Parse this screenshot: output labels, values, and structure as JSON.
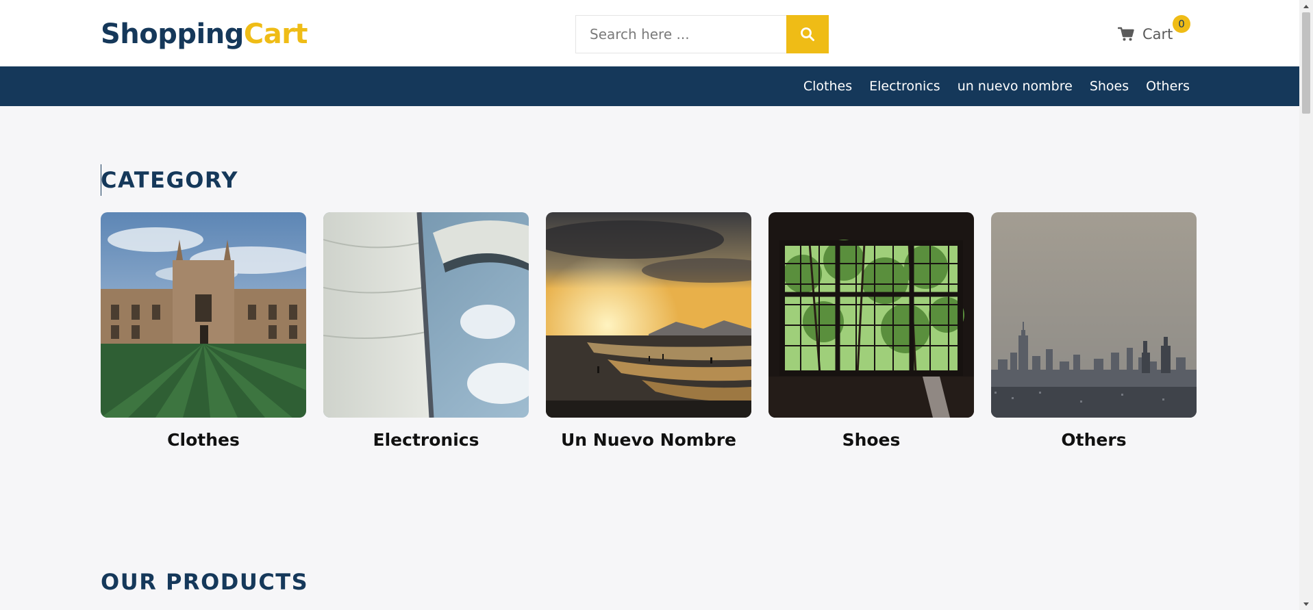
{
  "brand": {
    "part1": "Shopping",
    "part2": "Cart"
  },
  "search": {
    "placeholder": "Search here ...",
    "icon": "search-icon"
  },
  "cart": {
    "label": "Cart",
    "count": "0",
    "icon": "cart-icon"
  },
  "nav": {
    "items": [
      {
        "label": "Clothes"
      },
      {
        "label": "Electronics"
      },
      {
        "label": "un nuevo nombre"
      },
      {
        "label": "Shoes"
      },
      {
        "label": "Others"
      }
    ]
  },
  "category_section": {
    "title": "CATEGORY",
    "cards": [
      {
        "label": "Clothes",
        "image": "college-building-lawn-photo"
      },
      {
        "label": "Electronics",
        "image": "sail-against-sky-photo"
      },
      {
        "label": "Un Nuevo Nombre",
        "image": "beach-sunset-photo"
      },
      {
        "label": "Shoes",
        "image": "window-trees-photo"
      },
      {
        "label": "Others",
        "image": "city-skyline-haze-photo"
      }
    ]
  },
  "products_section": {
    "title": "OUR PRODUCTS"
  },
  "colors": {
    "primary": "#15385a",
    "accent": "#efbc16",
    "background": "#f6f6f8"
  }
}
